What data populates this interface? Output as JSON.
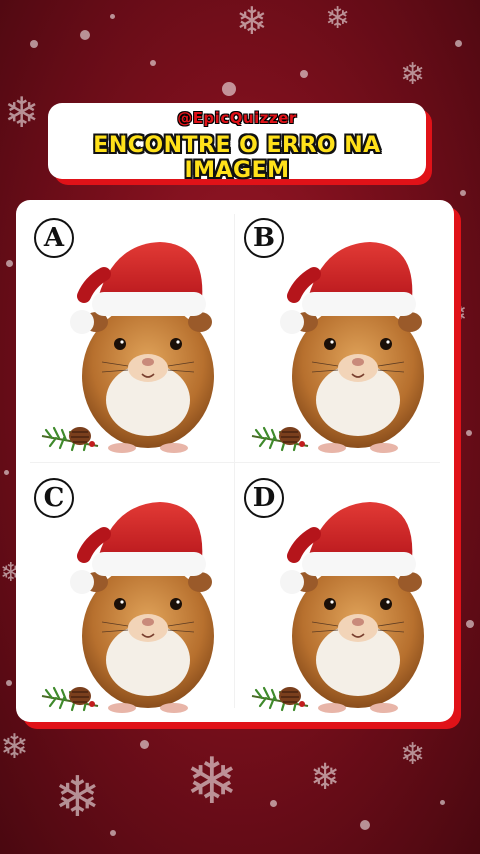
{
  "header": {
    "handle": "@EpicQuizzer",
    "headline": "ENCONTRE O ERRO NA IMAGEM"
  },
  "options": [
    {
      "letter": "A"
    },
    {
      "letter": "B"
    },
    {
      "letter": "C"
    },
    {
      "letter": "D"
    }
  ],
  "colors": {
    "background": "#7a0f1c",
    "accent_red": "#e01218",
    "headline_yellow": "#ffe11a",
    "card": "#ffffff"
  },
  "icons": [
    "guinea-pig-santa-hat-illustration",
    "pine-branch-pinecone-icon",
    "snowflake-icon"
  ]
}
